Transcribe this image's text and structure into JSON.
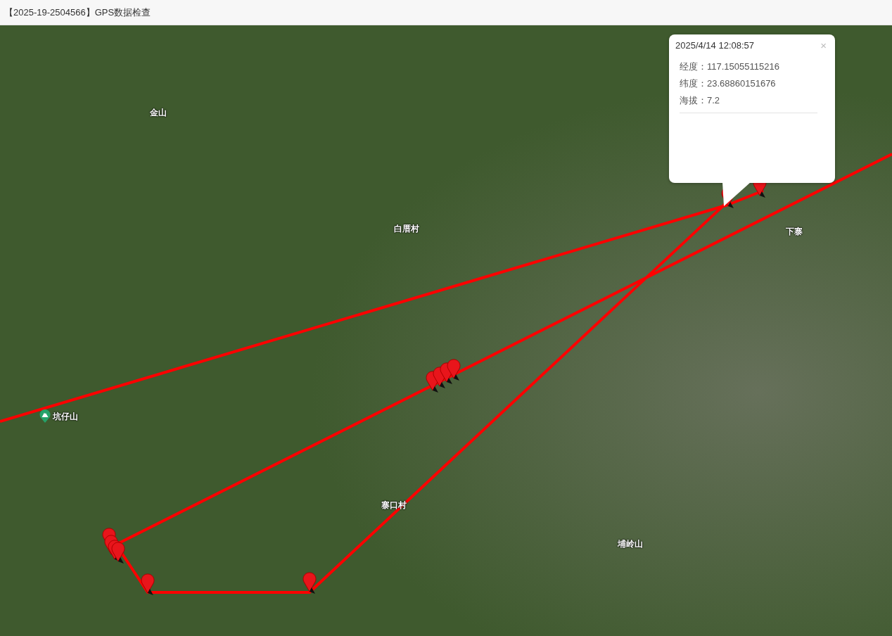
{
  "window": {
    "title": "【2025-19-2504566】GPS数据检查"
  },
  "map_labels": [
    {
      "text": "金山",
      "kind": "place"
    },
    {
      "text": "白厝村",
      "kind": "place"
    },
    {
      "text": "下寨",
      "kind": "place"
    },
    {
      "text": "坑仔山",
      "kind": "peak"
    },
    {
      "text": "寨口村",
      "kind": "place"
    },
    {
      "text": "埔岭山",
      "kind": "place"
    }
  ],
  "popup": {
    "title": "2025/4/14 12:08:57",
    "close": "×",
    "lines": [
      "经度：117.15055115216",
      "纬度：23.68860151676",
      "海拔：7.2"
    ]
  }
}
